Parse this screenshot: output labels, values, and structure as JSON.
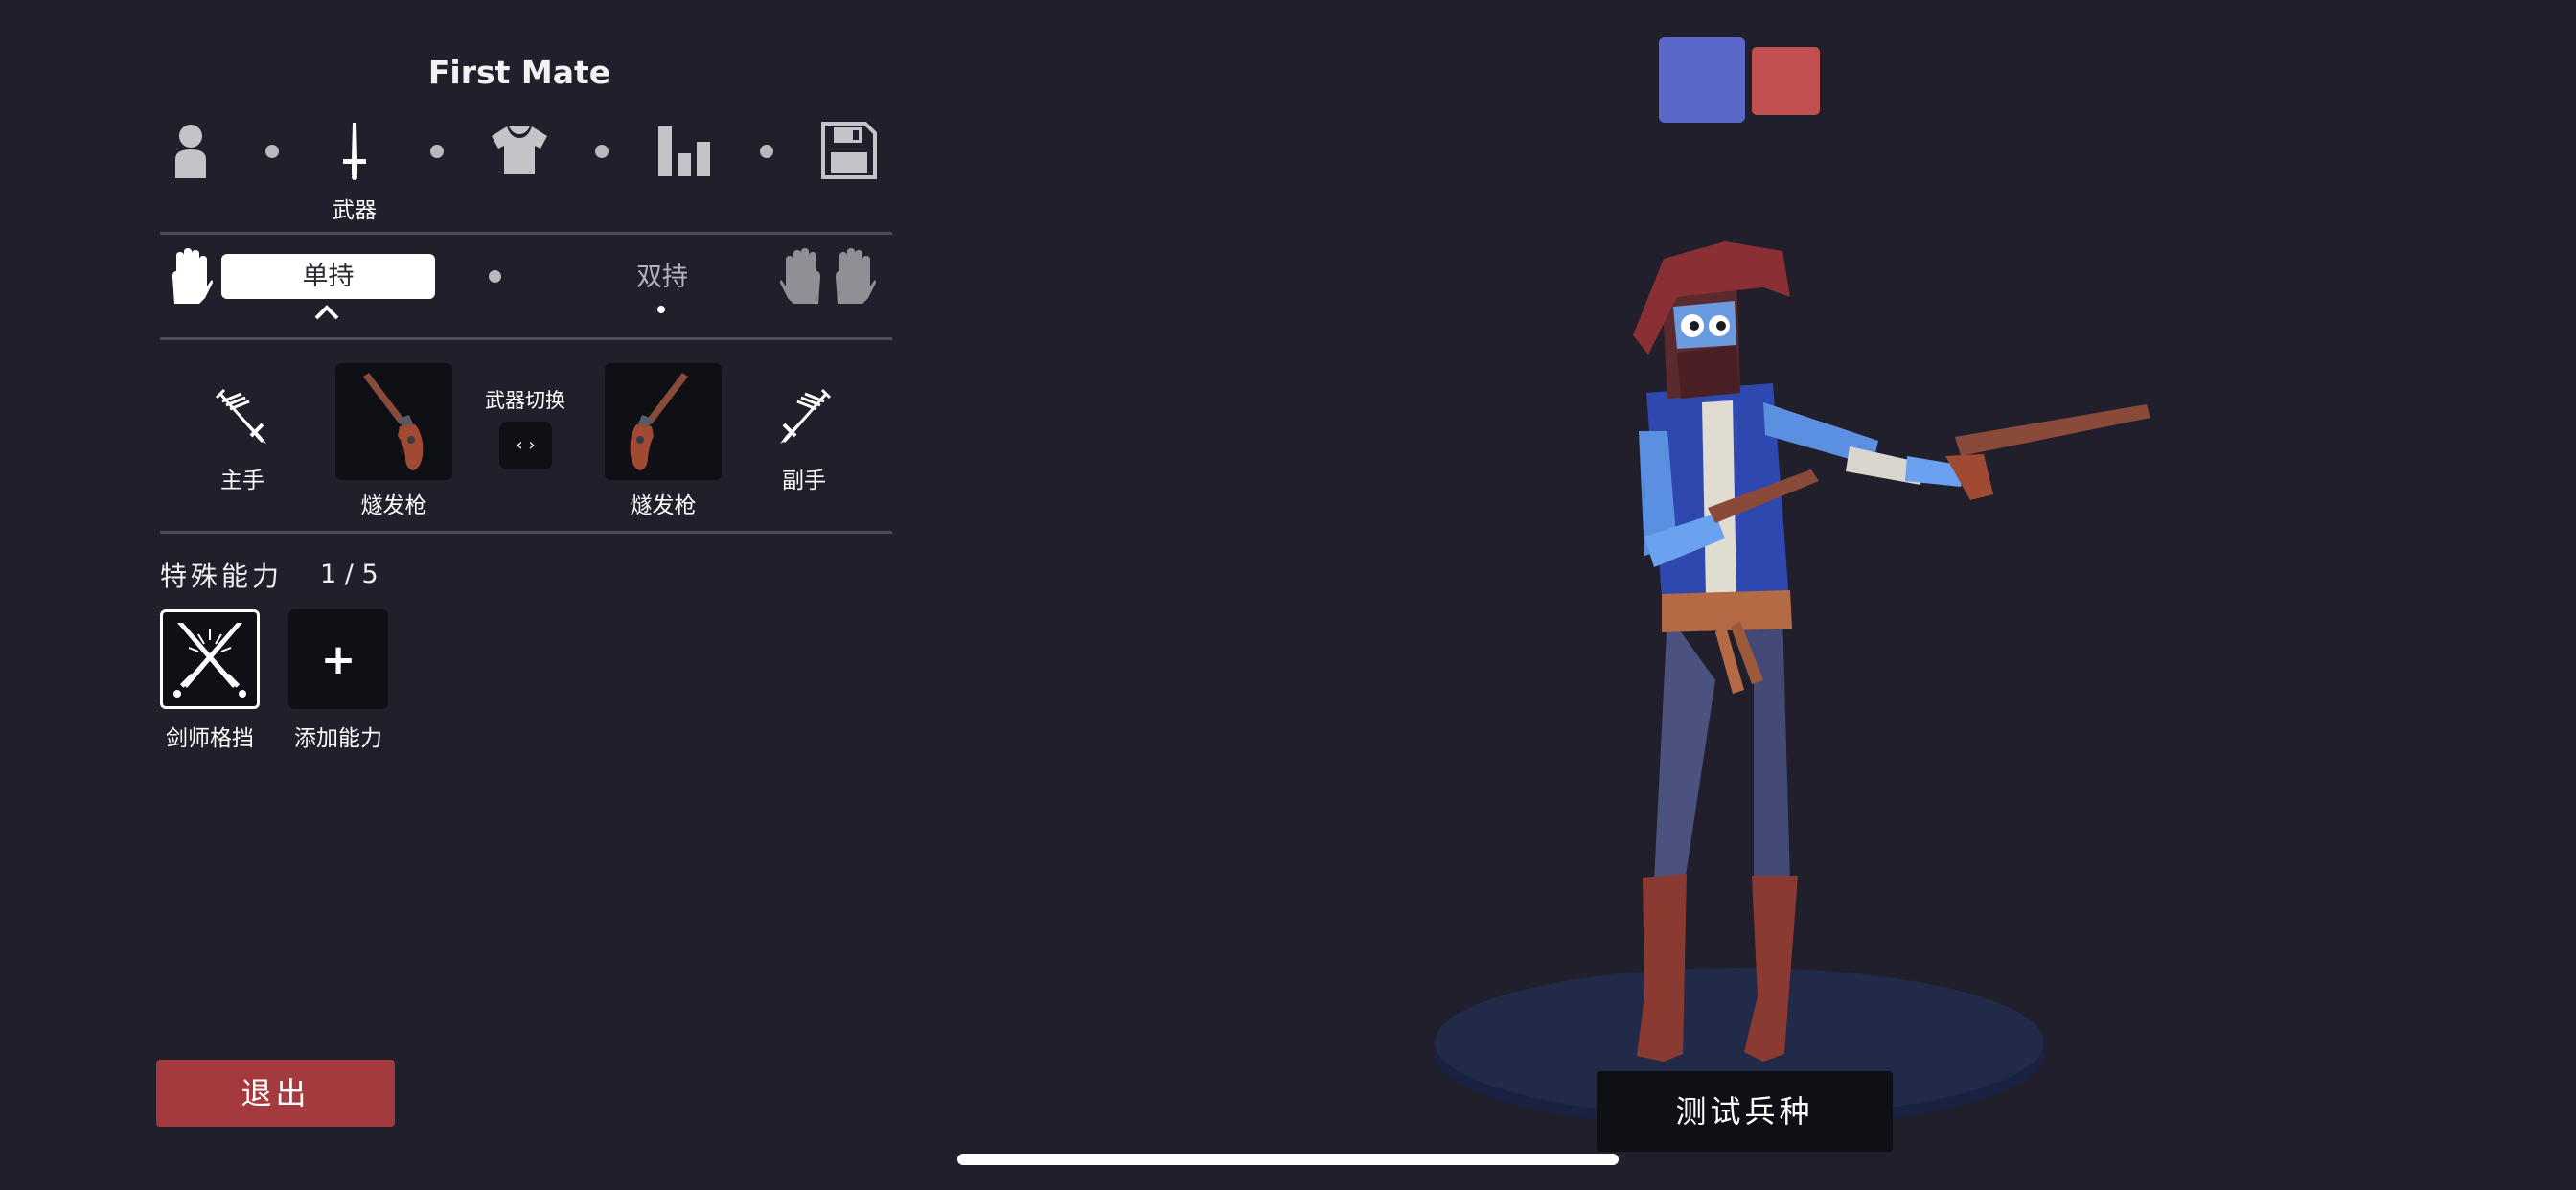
{
  "unit_name": "First Mate",
  "nav": {
    "items": [
      {
        "icon": "person-icon",
        "label": ""
      },
      {
        "icon": "sword-icon",
        "label": "武器"
      },
      {
        "icon": "shirt-icon",
        "label": ""
      },
      {
        "icon": "stats-icon",
        "label": ""
      },
      {
        "icon": "save-icon",
        "label": ""
      }
    ]
  },
  "grip": {
    "single_label": "单持",
    "dual_label": "双持"
  },
  "weapons": {
    "main_hand_label": "主手",
    "off_hand_label": "副手",
    "slot1_label": "燧发枪",
    "slot2_label": "燧发枪",
    "swap_label": "武器切换",
    "swap_button": "‹ ›"
  },
  "abilities": {
    "title": "特殊能力",
    "count": "1 / 5",
    "items": [
      {
        "label": "剑师格挡",
        "icon": "crossed-swords-icon"
      },
      {
        "label": "添加能力",
        "icon": "plus-icon",
        "symbol": "+"
      }
    ]
  },
  "buttons": {
    "exit": "退出",
    "test_unit": "测试兵种"
  },
  "team_colors": {
    "blue": "#5968c9",
    "red": "#c25050"
  }
}
